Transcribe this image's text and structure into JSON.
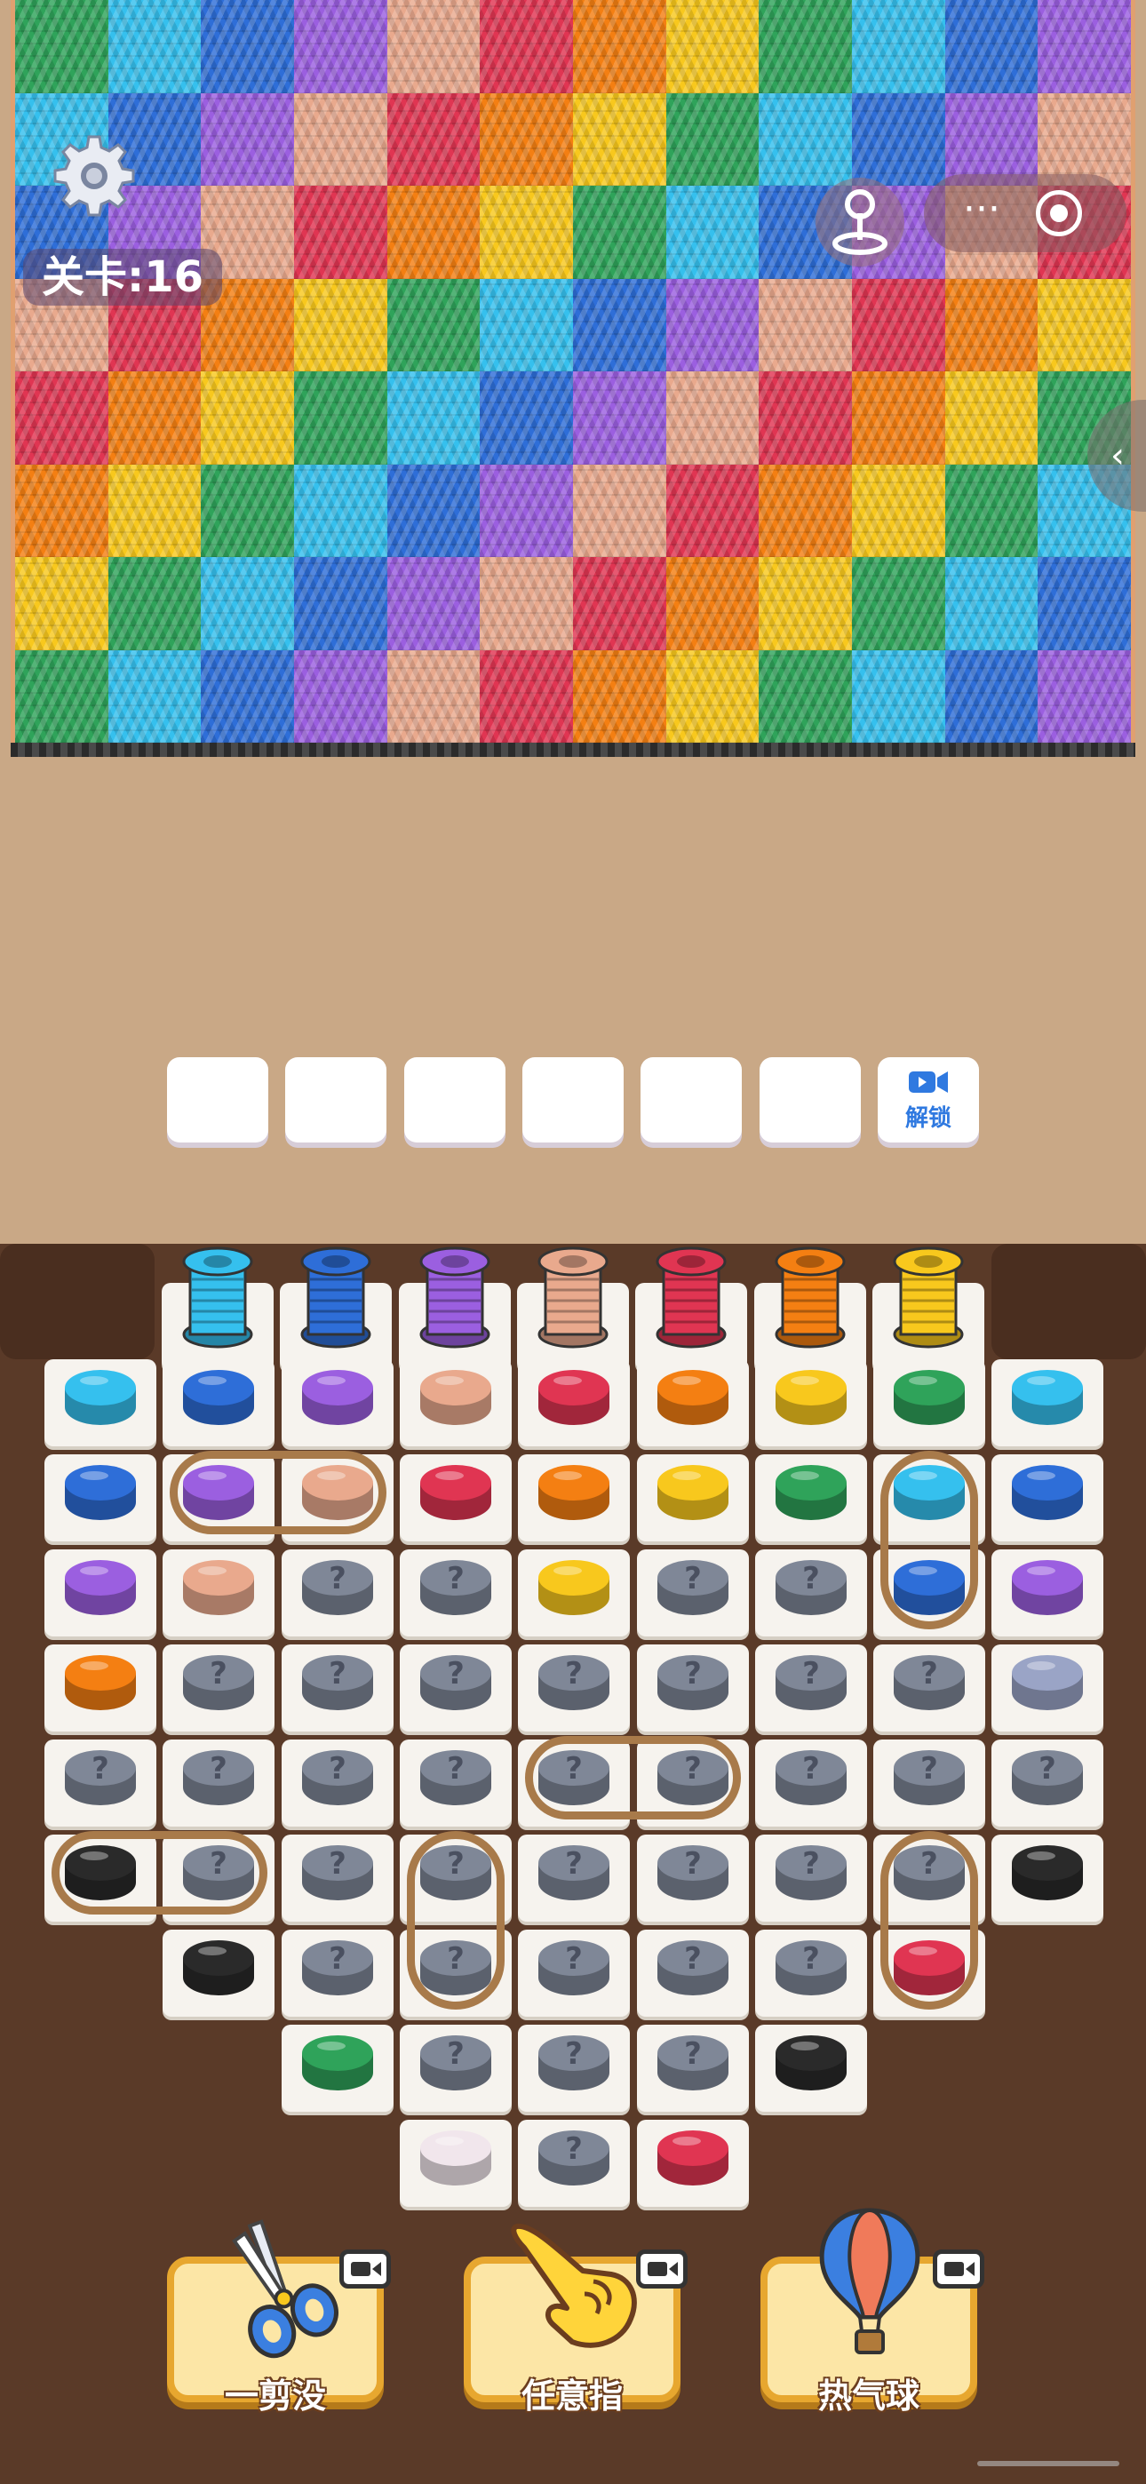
{
  "game": {
    "level_label": "关卡:16",
    "buffer_unlock_label": "解锁",
    "buffer_slots_empty": 6
  },
  "icons": {
    "settings": "gear-icon",
    "joystick": "joystick-icon",
    "more": "more-dots-icon",
    "record": "record-icon",
    "side_tab": "chevron-left-icon",
    "unlock": "video-camera-icon"
  },
  "capsule": {
    "more_label": "···"
  },
  "side_tab": {
    "glyph": "‹"
  },
  "palette": {
    "cyan": "#35c0ee",
    "blue": "#2e6ed8",
    "purple": "#9b5fe0",
    "peach": "#e9a98d",
    "red": "#e03552",
    "orange": "#f47f12",
    "yellow": "#f8c81d",
    "green": "#2fa35a",
    "black": "#2a2a2a",
    "mystery": "#7f8797",
    "ghost": "#9aa4c6",
    "white": "#f1e6ec"
  },
  "blanket_rows": [
    [
      "green",
      "cyan",
      "blue",
      "purple",
      "peach",
      "red",
      "orange",
      "yellow",
      "green",
      "cyan",
      "blue",
      "purple"
    ],
    [
      "cyan",
      "blue",
      "purple",
      "peach",
      "red",
      "orange",
      "yellow",
      "green",
      "cyan",
      "blue",
      "purple",
      "peach"
    ],
    [
      "blue",
      "purple",
      "peach",
      "red",
      "orange",
      "yellow",
      "green",
      "cyan",
      "blue",
      "purple",
      "peach",
      "red"
    ],
    [
      "peach",
      "red",
      "orange",
      "yellow",
      "green",
      "cyan",
      "blue",
      "purple",
      "peach",
      "red",
      "orange",
      "yellow"
    ],
    [
      "red",
      "orange",
      "yellow",
      "green",
      "cyan",
      "blue",
      "purple",
      "peach",
      "red",
      "orange",
      "yellow",
      "green"
    ],
    [
      "orange",
      "yellow",
      "green",
      "cyan",
      "blue",
      "purple",
      "peach",
      "red",
      "orange",
      "yellow",
      "green",
      "cyan"
    ],
    [
      "yellow",
      "green",
      "cyan",
      "blue",
      "purple",
      "peach",
      "red",
      "orange",
      "yellow",
      "green",
      "cyan",
      "blue"
    ],
    [
      "green",
      "cyan",
      "blue",
      "purple",
      "peach",
      "red",
      "orange",
      "yellow",
      "green",
      "cyan",
      "blue",
      "purple"
    ]
  ],
  "spool_rack": [
    "cyan",
    "blue",
    "purple",
    "peach",
    "red",
    "orange",
    "yellow"
  ],
  "board_rows": [
    [
      "cyan",
      "blue",
      "purple",
      "peach",
      "red",
      "orange",
      "yellow",
      "green",
      "cyan"
    ],
    [
      "blue",
      "purple",
      "peach",
      "red",
      "orange",
      "yellow",
      "green",
      "cyan",
      "blue"
    ],
    [
      "purple",
      "peach",
      "mystery",
      "mystery",
      "yellow",
      "mystery",
      "mystery",
      "blue",
      "purple"
    ],
    [
      "orange",
      "mystery",
      "mystery",
      "mystery",
      "mystery",
      "mystery",
      "mystery",
      "mystery",
      "ghost"
    ],
    [
      "mystery",
      "mystery",
      "mystery",
      "mystery",
      "mystery",
      "mystery",
      "mystery",
      "mystery",
      "mystery"
    ],
    [
      "black",
      "mystery",
      "mystery",
      "mystery",
      "mystery",
      "mystery",
      "mystery",
      "mystery",
      "black"
    ],
    [
      null,
      "black",
      "mystery",
      "mystery",
      "mystery",
      "mystery",
      "mystery",
      "red",
      null
    ],
    [
      null,
      null,
      "green",
      "mystery",
      "mystery",
      "mystery",
      "black",
      null,
      null
    ],
    [
      null,
      null,
      null,
      "white",
      "mystery",
      "red",
      null,
      null,
      null
    ]
  ],
  "boosters": [
    {
      "label": "一剪没",
      "icon": "scissors-icon"
    },
    {
      "label": "任意指",
      "icon": "pointing-hand-icon"
    },
    {
      "label": "热气球",
      "icon": "hot-air-balloon-icon"
    }
  ]
}
